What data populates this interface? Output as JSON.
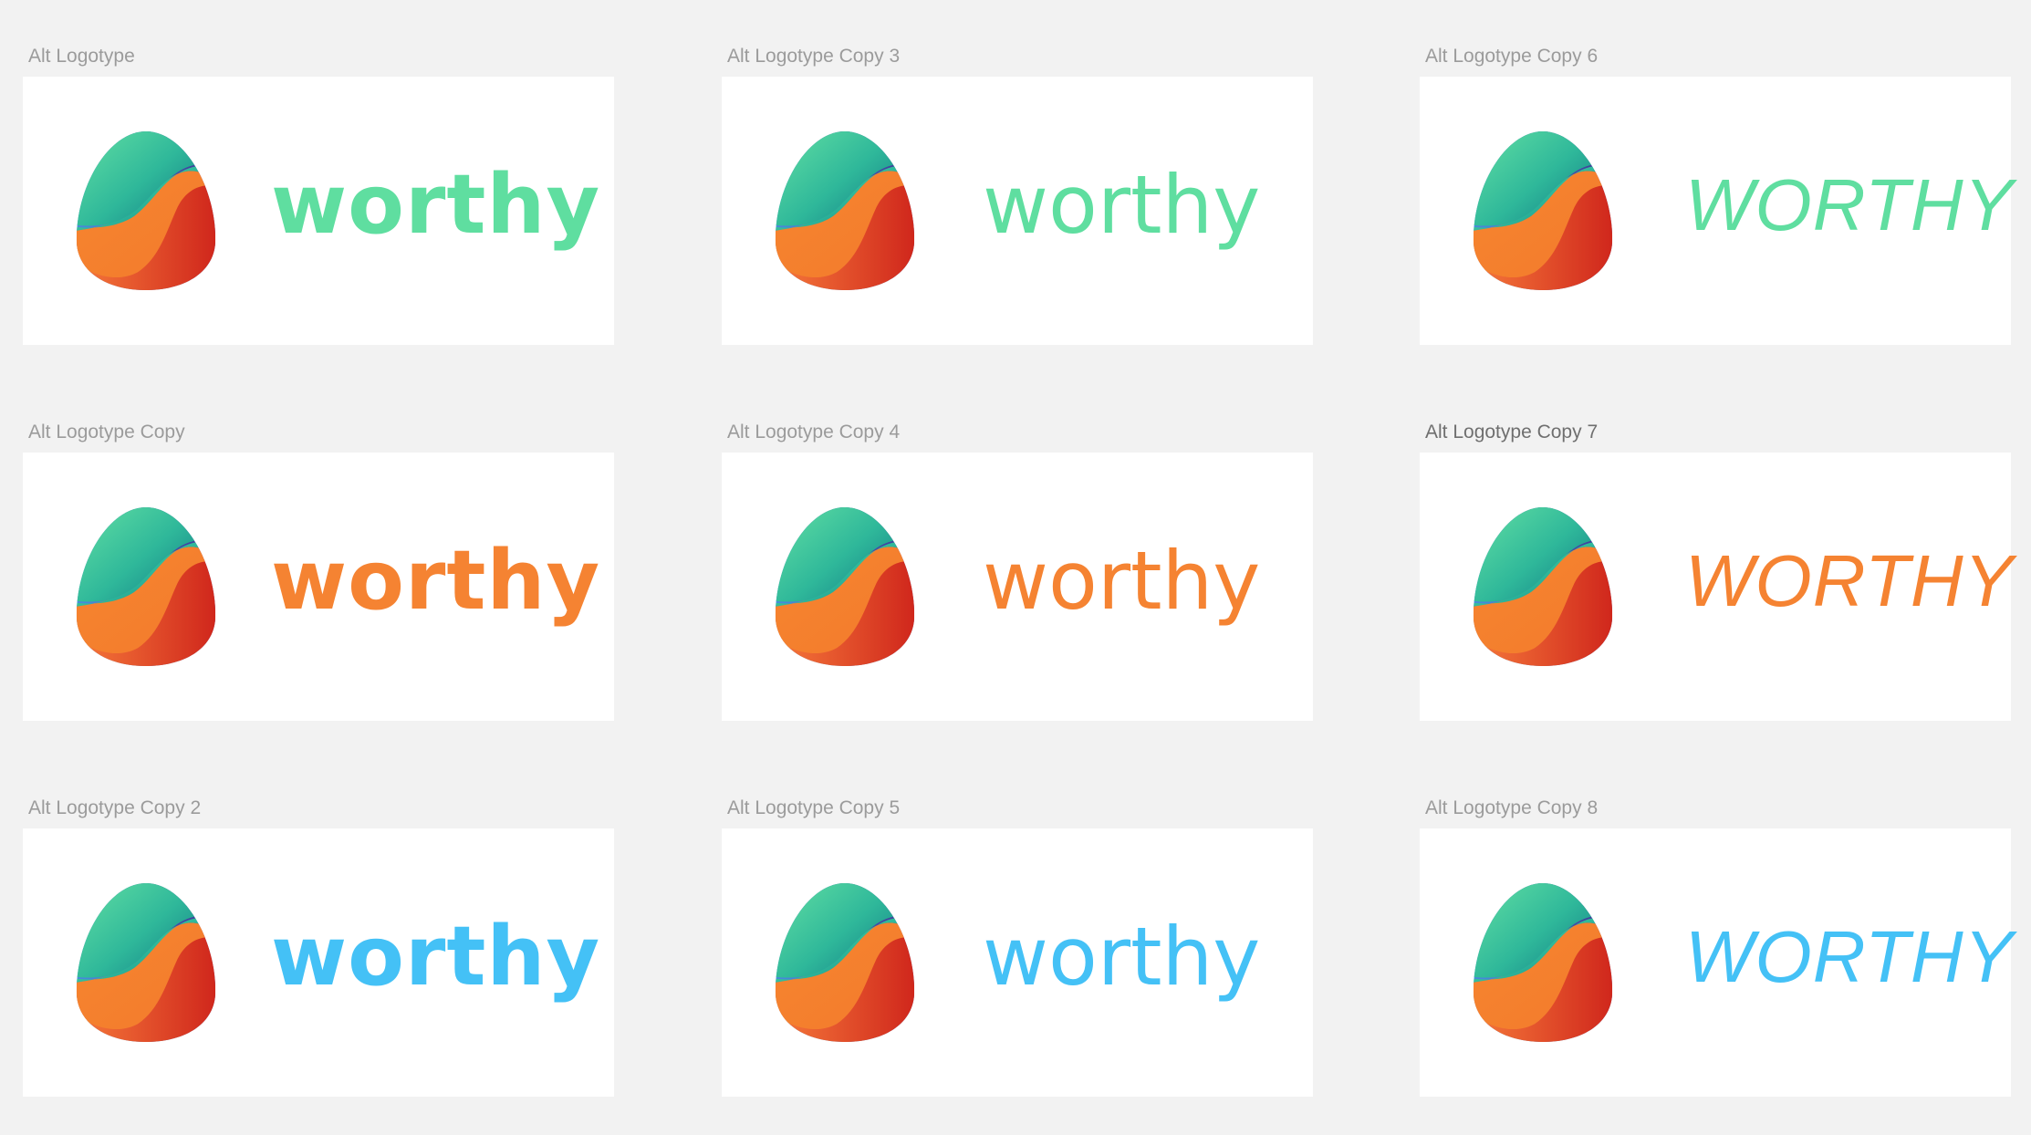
{
  "canvas": {
    "background": "#f2f2f2"
  },
  "colors": {
    "green": "#5fdea0",
    "orange": "#f58332",
    "blue": "#44c1f6",
    "label": "#9b9b9b",
    "label_active": "#6f6f6f",
    "artboard_bg": "#ffffff"
  },
  "mark_icon": "worthy-egg-logo-icon",
  "artboards": [
    {
      "label": "Alt Logotype",
      "wordmark": "worthy",
      "style": "bold",
      "color": "green",
      "selected": false
    },
    {
      "label": "Alt Logotype Copy 3",
      "wordmark": "worthy",
      "style": "light",
      "color": "green",
      "selected": false
    },
    {
      "label": "Alt Logotype Copy 6",
      "wordmark": "WORTHY",
      "style": "italic",
      "color": "green",
      "selected": false
    },
    {
      "label": "Alt Logotype Copy",
      "wordmark": "worthy",
      "style": "bold",
      "color": "orange",
      "selected": false
    },
    {
      "label": "Alt Logotype Copy 4",
      "wordmark": "worthy",
      "style": "light",
      "color": "orange",
      "selected": false
    },
    {
      "label": "Alt Logotype Copy 7",
      "wordmark": "WORTHY",
      "style": "italic",
      "color": "orange",
      "selected": true
    },
    {
      "label": "Alt Logotype Copy 2",
      "wordmark": "worthy",
      "style": "bold",
      "color": "blue",
      "selected": false
    },
    {
      "label": "Alt Logotype Copy 5",
      "wordmark": "worthy",
      "style": "light",
      "color": "blue",
      "selected": false
    },
    {
      "label": "Alt Logotype Copy 8",
      "wordmark": "WORTHY",
      "style": "italic",
      "color": "blue",
      "selected": false
    }
  ]
}
